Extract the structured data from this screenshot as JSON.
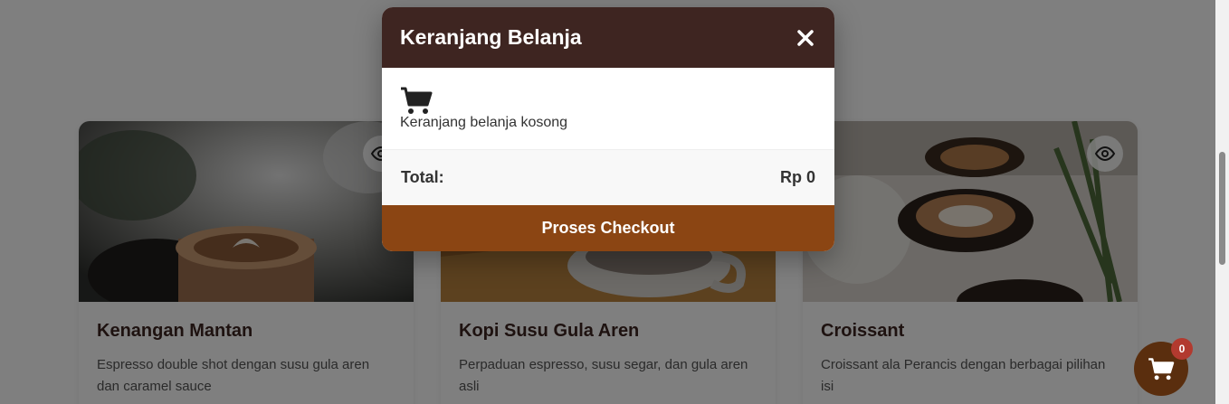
{
  "products": [
    {
      "title": "Kenangan Mantan",
      "description": "Espresso double shot dengan susu gula aren dan caramel sauce"
    },
    {
      "title": "Kopi Susu Gula Aren",
      "description": "Perpaduan espresso, susu segar, dan gula aren asli"
    },
    {
      "title": "Croissant",
      "description": "Croissant ala Perancis dengan berbagai pilihan isi"
    }
  ],
  "cart_modal": {
    "title": "Keranjang Belanja",
    "close_icon": "close-icon",
    "empty_icon": "shopping-cart-icon",
    "empty_text": "Keranjang belanja kosong",
    "total_label": "Total:",
    "total_value": "Rp 0",
    "checkout_label": "Proses Checkout"
  },
  "floating_cart": {
    "icon": "shopping-cart-icon",
    "count": "0"
  },
  "colors": {
    "header_bg": "#3e2521",
    "checkout_bg": "#8b4513",
    "fab_bg": "#5a2e0e",
    "badge_bg": "#b23a2f",
    "title_color": "#3d2420"
  }
}
